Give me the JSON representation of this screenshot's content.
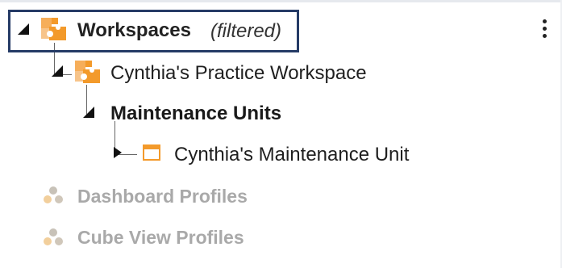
{
  "tree": {
    "root": {
      "label": "Workspaces",
      "filter_label": "(filtered)",
      "icon": "workspace-puzzle-icon",
      "expanded": true
    },
    "workspace": {
      "label": "Cynthia's Practice Workspace",
      "icon": "workspace-puzzle-icon",
      "expanded": true
    },
    "maintenance_units": {
      "label": "Maintenance Units",
      "expanded": true
    },
    "maintenance_unit": {
      "label": "Cynthia's Maintenance Unit",
      "icon": "window-icon",
      "expanded": false
    },
    "dashboard_profiles": {
      "label": "Dashboard Profiles",
      "icon": "profiles-cluster-icon"
    },
    "cube_view_profiles": {
      "label": "Cube View Profiles",
      "icon": "profiles-cluster-icon"
    }
  },
  "more_menu_icon": "vertical-ellipsis-icon",
  "colors": {
    "focus_border": "#253b66",
    "workspace_icon_orange": "#f39a2b",
    "workspace_icon_light": "#f7c48a",
    "disabled_text": "#a9a9a9",
    "disabled_icon": "#d9c9b3"
  }
}
